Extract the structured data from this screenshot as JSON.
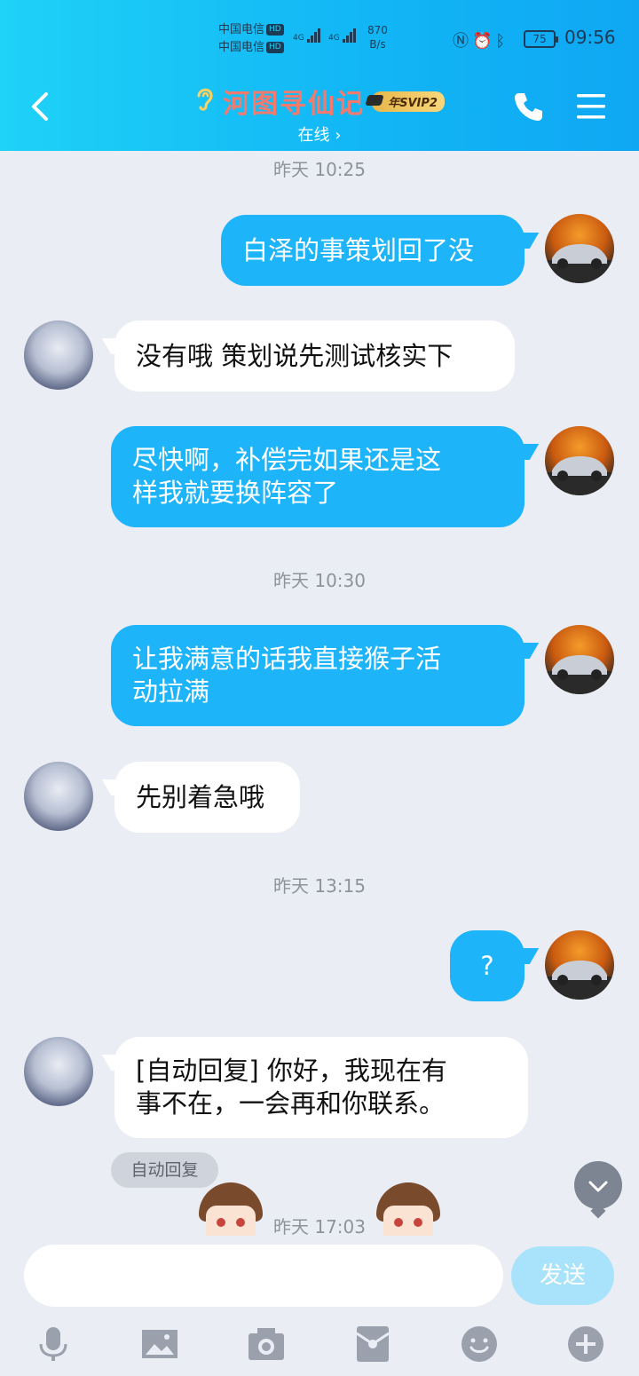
{
  "status_bar": {
    "carrier1": "中国电信",
    "carrier2": "中国电信",
    "hd": "HD",
    "net": "4G",
    "speed_value": "870",
    "speed_unit": "B/s",
    "battery": "75",
    "time": "09:56",
    "icons": [
      "nfc-icon",
      "alarm-icon",
      "bluetooth-icon"
    ]
  },
  "header": {
    "title": "河图寻仙记",
    "badge_prefix": "年",
    "badge": "SVIP2",
    "status": "在线 ›",
    "brand_color": "#12b7f5"
  },
  "timestamps": [
    "昨天 10:25",
    "昨天 10:30",
    "昨天 13:15",
    "昨天 17:03"
  ],
  "messages": [
    {
      "from": "me",
      "lines": [
        "白泽的事策划回了没"
      ]
    },
    {
      "from": "them",
      "lines": [
        "没有哦 策划说先测试核实下"
      ]
    },
    {
      "from": "me",
      "lines": [
        "尽快啊，补偿完如果还是这",
        "样我就要换阵容了"
      ]
    },
    {
      "from": "me",
      "lines": [
        "让我满意的话我直接猴子活",
        "动拉满"
      ]
    },
    {
      "from": "them",
      "lines": [
        "先别着急哦"
      ]
    },
    {
      "from": "me",
      "lines": [
        "?"
      ]
    },
    {
      "from": "them",
      "lines": [
        "[自动回复] 你好，我现在有",
        "事不在，一会再和你联系。"
      ]
    }
  ],
  "auto_reply_tag": "自动回复",
  "input": {
    "value": "",
    "placeholder": ""
  },
  "send_label": "发送",
  "toolbar": [
    "microphone-icon",
    "image-icon",
    "camera-icon",
    "red-packet-icon",
    "emoji-icon",
    "plus-icon"
  ]
}
